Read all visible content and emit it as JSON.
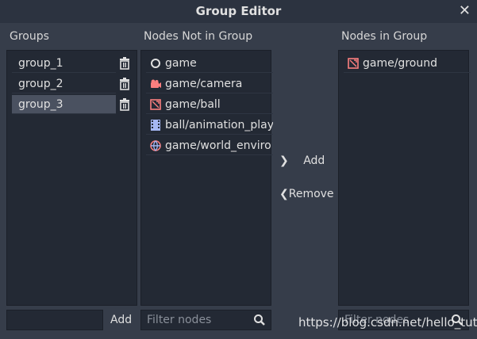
{
  "dialog": {
    "title": "Group Editor"
  },
  "groups_panel": {
    "header": "Groups",
    "items": [
      {
        "label": "group_1",
        "selected": false
      },
      {
        "label": "group_2",
        "selected": false
      },
      {
        "label": "group_3",
        "selected": true
      }
    ],
    "new_group_value": "",
    "add_label": "Add"
  },
  "not_in_group": {
    "header": "Nodes Not in Group",
    "items": [
      {
        "label": "game",
        "icon": "node-icon"
      },
      {
        "label": "game/camera",
        "icon": "camera-icon"
      },
      {
        "label": "game/ball",
        "icon": "rigidbody-icon"
      },
      {
        "label": "ball/animation_play",
        "icon": "animation-player-icon"
      },
      {
        "label": "game/world_enviro",
        "icon": "world-environment-icon"
      }
    ],
    "filter_placeholder": "Filter nodes"
  },
  "actions": {
    "add_label": "Add",
    "remove_label": "Remove"
  },
  "in_group": {
    "header": "Nodes in Group",
    "items": [
      {
        "label": "game/ground",
        "icon": "rigidbody-icon"
      }
    ],
    "filter_placeholder": "Filter nodes"
  },
  "watermark": "https://blog.csdn.net/hello_tute",
  "colors": {
    "background": "#363d4a",
    "panel": "#232934",
    "selected": "#4a5160",
    "icon_red": "#fc7f7f",
    "icon_purple": "#a5b7f3"
  }
}
